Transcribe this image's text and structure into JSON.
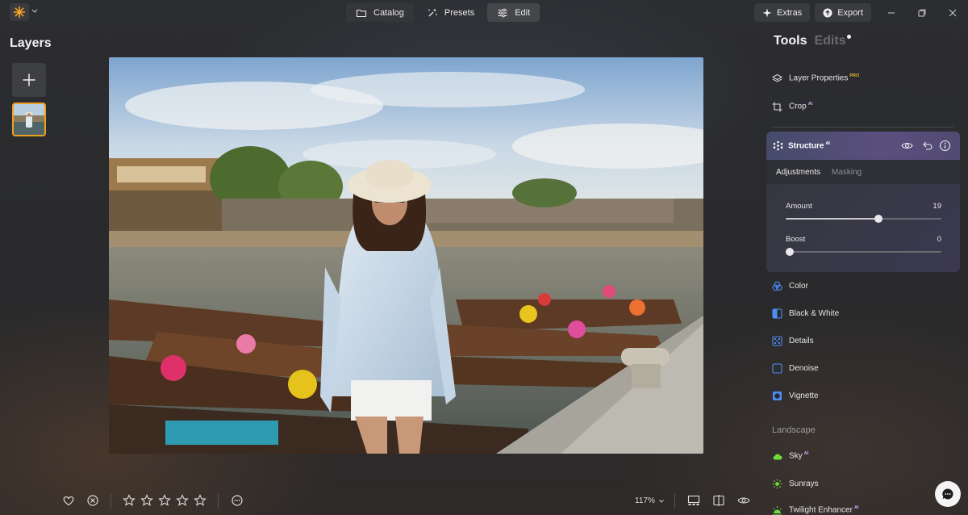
{
  "topbar": {
    "nav": [
      {
        "label": "Catalog",
        "icon": "folder-icon",
        "active": false
      },
      {
        "label": "Presets",
        "icon": "sparkle-wand-icon",
        "active": false
      },
      {
        "label": "Edit",
        "icon": "sliders-icon",
        "active": true
      }
    ],
    "extras_label": "Extras",
    "export_label": "Export"
  },
  "layers": {
    "title": "Layers"
  },
  "bottombar": {
    "zoom": "117%"
  },
  "tools_panel": {
    "tab_tools": "Tools",
    "tab_edits": "Edits",
    "items_top": [
      {
        "label": "Layer Properties",
        "badge": "PRO",
        "icon": "layers-icon"
      },
      {
        "label": "Crop",
        "badge": "AI",
        "icon": "crop-icon"
      }
    ],
    "structure": {
      "title": "Structure",
      "badge": "AI",
      "subtab_adjustments": "Adjustments",
      "subtab_masking": "Masking",
      "sliders": [
        {
          "label": "Amount",
          "value": "19",
          "fraction": 0.595
        },
        {
          "label": "Boost",
          "value": "0",
          "fraction": 0.025
        }
      ]
    },
    "items_mid": [
      {
        "label": "Color",
        "icon": "color-icon"
      },
      {
        "label": "Black & White",
        "icon": "black-white-icon"
      },
      {
        "label": "Details",
        "icon": "details-icon"
      },
      {
        "label": "Denoise",
        "icon": "denoise-icon"
      },
      {
        "label": "Vignette",
        "icon": "vignette-icon"
      }
    ],
    "landscape_section": "Landscape",
    "items_landscape": [
      {
        "label": "Sky",
        "badge": "AI",
        "icon": "cloud-icon"
      },
      {
        "label": "Sunrays",
        "icon": "sun-icon"
      },
      {
        "label": "Twilight Enhancer",
        "badge": "AI",
        "icon": "twilight-icon"
      }
    ]
  },
  "colors": {
    "accent_orange": "#f0a020",
    "structure_gradient": "#5b4f7f",
    "icon_blue": "#4d8df6",
    "icon_green": "#6ddc3c"
  }
}
